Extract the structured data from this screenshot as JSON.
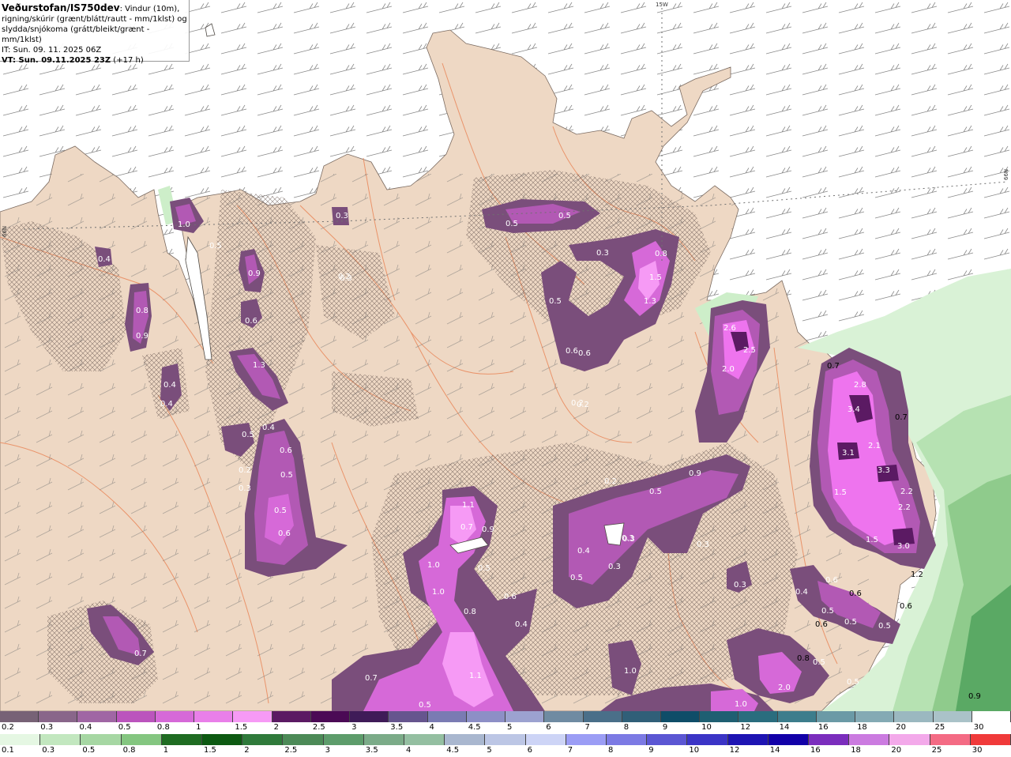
{
  "header": {
    "title": "Veðurstofan/IS750dev",
    "desc_1": ": Vindur (10m),",
    "desc_2": "rigning/skúrir (grænt/blátt/rautt - mm/1klst) og",
    "desc_3": "slydda/snjókoma (grátt/bleikt/grænt - mm/1klst)",
    "it": "IT: Sun. 09. 11. 2025 06Z",
    "vt": "VT: Sun. 09.11.2025 23Z",
    "vt_offset": " (+17 h)"
  },
  "graticule": {
    "top": "15W",
    "left": "66N",
    "right": "66N"
  },
  "colors": {
    "land": "#eed8c4",
    "sea": "#ffffff",
    "roads": "#e9875a",
    "snow_light": "#7a4e7b",
    "snow_mid": "#b259b4",
    "snow_heavy": "#ee74ee",
    "snow_max": "#5b1a63",
    "rain_light": "#cdeecd",
    "rain_mid": "#9fd59f",
    "rain_heavy": "#5da86a"
  },
  "values": [
    "1.0",
    "0.4",
    "0.9",
    "0.3",
    "0.2",
    "0.8",
    "0.9",
    "0.6",
    "0.5",
    "0.5",
    "0.6",
    "0.5",
    "1.3",
    "0.3",
    "0.2",
    "0.4",
    "0.4",
    "0.4",
    "0.5",
    "0.5",
    "0.2",
    "0.3",
    "0.5",
    "0.6",
    "0.6",
    "0.7",
    "1.1",
    "0.9",
    "1.0",
    "0.5",
    "1.0",
    "0.8",
    "0.4",
    "1.1",
    "0.5",
    "0.7",
    "0.4",
    "0.3",
    "0.3",
    "0.5",
    "0.9",
    "0.3",
    "0.3",
    "0.8",
    "1.5",
    "1.3",
    "0.5",
    "0.6",
    "0.3",
    "0.2",
    "2.6",
    "2.5",
    "2.0",
    "0.7",
    "2.8",
    "3.4",
    "0.7",
    "2.1",
    "3.1",
    "3.3",
    "2.2",
    "1.5",
    "2.2",
    "1.5",
    "3.0",
    "1.2",
    "0.4",
    "0.6",
    "0.6",
    "0.5",
    "0.5",
    "0.6",
    "0.6",
    "0.8",
    "0.5",
    "0.5",
    "2.0",
    "0.5",
    "1.0",
    "0.9",
    "1.0",
    "0.6",
    "0.5",
    "0.7",
    "0.3",
    "0.2"
  ],
  "legend_snow": {
    "labels": [
      "0.2",
      "0.3",
      "0.4",
      "0.5",
      "0.8",
      "1",
      "1.5",
      "2",
      "2.5",
      "3",
      "3.5",
      "4",
      "4.5",
      "5",
      "6",
      "7",
      "8",
      "9",
      "10",
      "12",
      "14",
      "16",
      "18",
      "20",
      "25",
      "30"
    ],
    "colors": [
      "#776276",
      "#89668a",
      "#a066a4",
      "#bb54bd",
      "#d669d8",
      "#e97fe9",
      "#f69af5",
      "#5b1a63",
      "#4b0a55",
      "#3f1b58",
      "#66558e",
      "#7a7bb3",
      "#8d8fc6",
      "#9ca2d0",
      "#6f8ba2",
      "#4a6f89",
      "#305f78",
      "#0f4d68",
      "#1f5f72",
      "#2a6d7e",
      "#3d7d8c",
      "#6b9aa6",
      "#84aab4",
      "#9bb8c0",
      "#aac2c8",
      "#ffffff"
    ]
  },
  "legend_rain": {
    "labels": [
      "0.1",
      "0.3",
      "0.5",
      "0.8",
      "1",
      "1.5",
      "2",
      "2.5",
      "3",
      "3.5",
      "4",
      "4.5",
      "5",
      "6",
      "7",
      "8",
      "9",
      "10",
      "12",
      "14",
      "16",
      "18",
      "20",
      "25",
      "30"
    ],
    "colors": [
      "#e5f7e3",
      "#c2e7bf",
      "#a6d7a3",
      "#84c680",
      "#1f6c22",
      "#0d5a12",
      "#2f7a3b",
      "#4c8a57",
      "#5d9c6b",
      "#7bab88",
      "#94bfa1",
      "#a9b7cf",
      "#bcc6e5",
      "#cdd4f6",
      "#9b9df5",
      "#7c7ae4",
      "#5b56d3",
      "#3b34c6",
      "#1e14b3",
      "#1200a8",
      "#7b2dbd",
      "#cb7be0",
      "#f3a9ea",
      "#f46b84",
      "#f03a3a"
    ]
  }
}
